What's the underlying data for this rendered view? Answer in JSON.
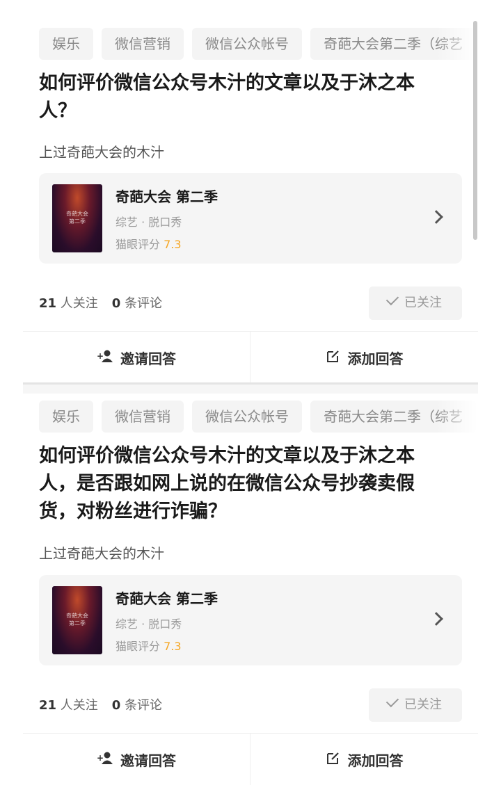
{
  "questions": [
    {
      "tags": [
        "娱乐",
        "微信营销",
        "微信公众帐号",
        "奇葩大会第二季（综艺"
      ],
      "title": "如何评价微信公众号木汁的文章以及于沐之本人？",
      "description": "上过奇葩大会的木汁",
      "media": {
        "poster_text_line1": "奇葩大会",
        "poster_text_line2": "第二季",
        "title": "奇葩大会 第二季",
        "subtitle": "综艺 · 脱口秀",
        "score_label": "猫眼评分",
        "score": "7.3"
      },
      "followers_count": "21",
      "followers_label": "人关注",
      "comments_count": "0",
      "comments_label": "条评论",
      "follow_button": "已关注",
      "invite_label": "邀请回答",
      "answer_label": "添加回答"
    },
    {
      "tags": [
        "娱乐",
        "微信营销",
        "微信公众帐号",
        "奇葩大会第二季（综艺"
      ],
      "title": "如何评价微信公众号木汁的文章以及于沐之本人，是否跟如网上说的在微信公众号抄袭卖假货，对粉丝进行诈骗？",
      "description": "上过奇葩大会的木汁",
      "media": {
        "poster_text_line1": "奇葩大会",
        "poster_text_line2": "第二季",
        "title": "奇葩大会 第二季",
        "subtitle": "综艺 · 脱口秀",
        "score_label": "猫眼评分",
        "score": "7.3"
      },
      "followers_count": "21",
      "followers_label": "人关注",
      "comments_count": "0",
      "comments_label": "条评论",
      "follow_button": "已关注",
      "invite_label": "邀请回答",
      "answer_label": "添加回答"
    }
  ],
  "colors": {
    "accent_score": "#f5a623",
    "tag_bg": "#f4f4f4",
    "media_bg": "#f5f5f5"
  },
  "icons": {
    "invite": "add-user-icon",
    "answer": "edit-icon",
    "followed": "check-icon",
    "more": "chevron-right-icon"
  }
}
